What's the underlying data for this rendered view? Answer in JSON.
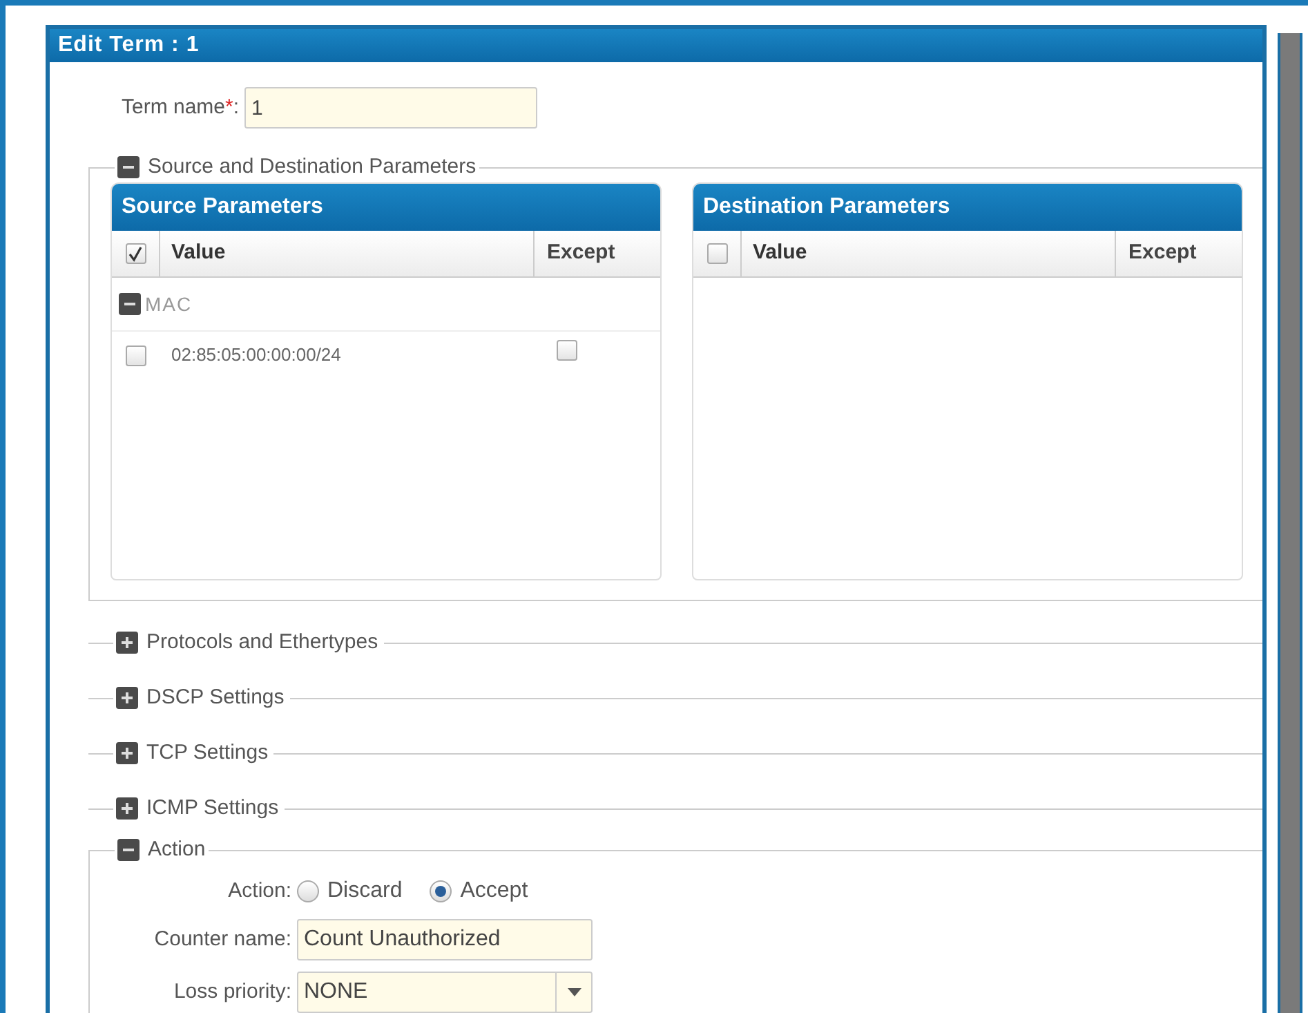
{
  "dialog": {
    "title": "Edit Term : 1"
  },
  "term_name": {
    "label": "Term name",
    "required_mark": "*",
    "suffix": ":",
    "value": "1"
  },
  "sections": [
    {
      "kind": "params",
      "title": "Source and Destination Parameters",
      "expanded": true,
      "panels": [
        {
          "title": "Source Parameters",
          "columns": [
            "Value",
            "Except"
          ],
          "all_checked": true,
          "groups": [
            {
              "title": "MAC",
              "expanded": true,
              "rows": [
                {
                  "value": "02:85:05:00:00:00/24",
                  "checked": false,
                  "except": false
                }
              ]
            }
          ]
        },
        {
          "title": "Destination Parameters",
          "columns": [
            "Value",
            "Except"
          ],
          "all_checked": false
        }
      ]
    },
    {
      "kind": "collapsed",
      "title": "Protocols and Ethertypes",
      "expanded": false
    },
    {
      "kind": "collapsed",
      "title": "DSCP Settings",
      "expanded": false
    },
    {
      "kind": "collapsed",
      "title": "TCP Settings",
      "expanded": false
    },
    {
      "kind": "collapsed",
      "title": "ICMP Settings",
      "expanded": false
    },
    {
      "kind": "action",
      "title": "Action",
      "expanded": true,
      "action": {
        "label": "Action:",
        "options": [
          {
            "label": "Discard",
            "selected": false
          },
          {
            "label": "Accept",
            "selected": true
          }
        ]
      },
      "counter": {
        "label": "Counter name:",
        "value": "Count Unauthorized"
      },
      "loss_priority": {
        "label": "Loss priority:",
        "value": "NONE"
      }
    }
  ]
}
